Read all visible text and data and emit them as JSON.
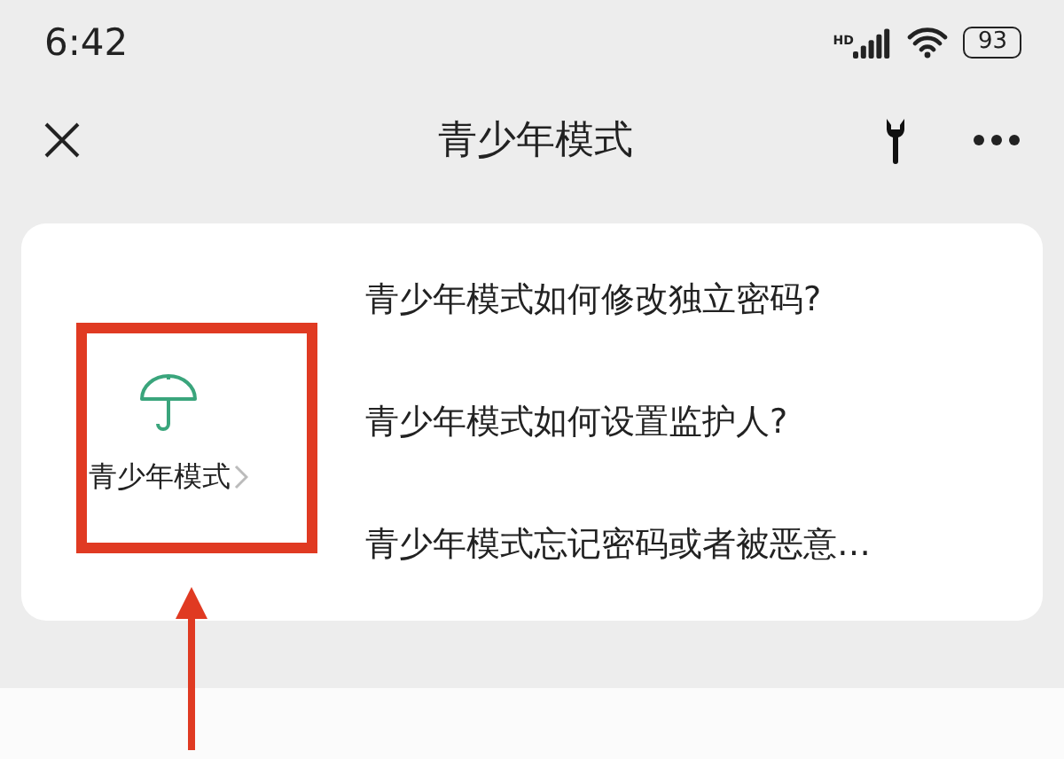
{
  "status_bar": {
    "time": "6:42",
    "network": "HD",
    "battery": "93"
  },
  "nav_bar": {
    "title": "青少年模式"
  },
  "card": {
    "entry": {
      "label": "青少年模式"
    },
    "questions": [
      "青少年模式如何修改独立密码?",
      "青少年模式如何设置监护人?",
      "青少年模式忘记密码或者被恶意…"
    ]
  }
}
